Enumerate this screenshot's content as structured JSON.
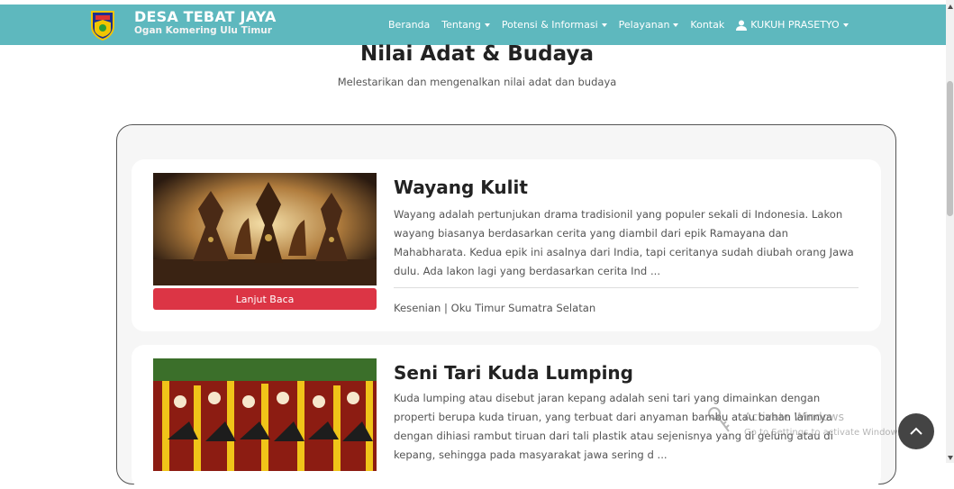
{
  "brand": {
    "title": "DESA TEBAT JAYA",
    "subtitle": "Ogan Komering Ulu Timur",
    "logo_icon": "village-emblem-icon"
  },
  "nav": {
    "home": "Beranda",
    "about": "Tentang",
    "potential": "Potensi & Informasi",
    "services": "Pelayanan",
    "contact": "Kontak",
    "user": "KUKUH PRASETYO",
    "user_icon": "user-icon"
  },
  "page": {
    "title": "Nilai Adat & Budaya",
    "subtitle": "Melestarikan dan mengenalkan nilai adat dan budaya"
  },
  "cards": [
    {
      "title": "Wayang Kulit",
      "description": "Wayang adalah pertunjukan drama tradisionil yang populer sekali di Indonesia. Lakon wayang biasanya berdasarkan cerita yang diambil dari epik Ramayana dan Mahabharata. Kedua epik ini asalnya dari India, tapi ceritanya sudah diubah orang Jawa dulu. Ada lakon lagi yang berdasarkan cerita Ind ...",
      "button_label": "Lanjut Baca",
      "meta": "Kesenian | Oku Timur Sumatra Selatan",
      "image": "wayang-kulit-photo"
    },
    {
      "title": "Seni Tari Kuda Lumping",
      "description": "Kuda lumping atau disebut jaran kepang adalah seni tari yang dimainkan dengan properti berupa kuda tiruan, yang terbuat dari anyaman bambu atau bahan lainnya dengan dihiasi rambut tiruan dari tali plastik atau sejenisnya yang di gelung atau di kepang, sehingga pada masyarakat jawa sering d ...",
      "image": "kuda-lumping-photo"
    }
  ],
  "watermark": {
    "title": "Activate Windows",
    "subtitle": "Go to Settings to activate Windows."
  },
  "colors": {
    "navbar": "#5eb8be",
    "button": "#dc3545"
  },
  "back_to_top_icon": "chevron-up-icon"
}
